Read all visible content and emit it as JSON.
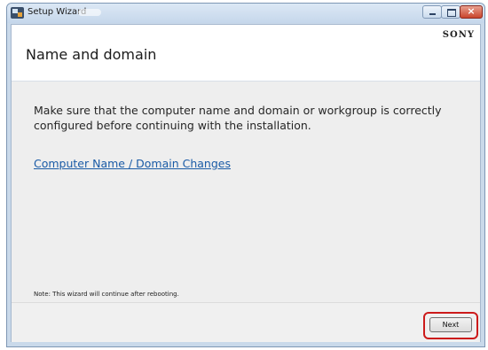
{
  "window": {
    "title": "Setup Wizard",
    "brand": "SONY",
    "title_close_symbol": "×"
  },
  "header": {
    "title": "Name and domain"
  },
  "main": {
    "instruction": "Make sure that the computer name and domain or workgroup is correctly configured before continuing with the installation.",
    "link_label": "Computer Name / Domain Changes",
    "note": "Note: This wizard will continue after rebooting."
  },
  "footer": {
    "next_label": "Next"
  },
  "colors": {
    "link": "#1a5ba6",
    "highlight": "#cc1b1b",
    "frame": "#c9d9ea",
    "content_bg": "#eeeeee"
  },
  "icons": {
    "app": "setup-wizard-app-icon",
    "minimize": "minimize-icon",
    "maximize": "maximize-icon",
    "close": "close-icon"
  }
}
